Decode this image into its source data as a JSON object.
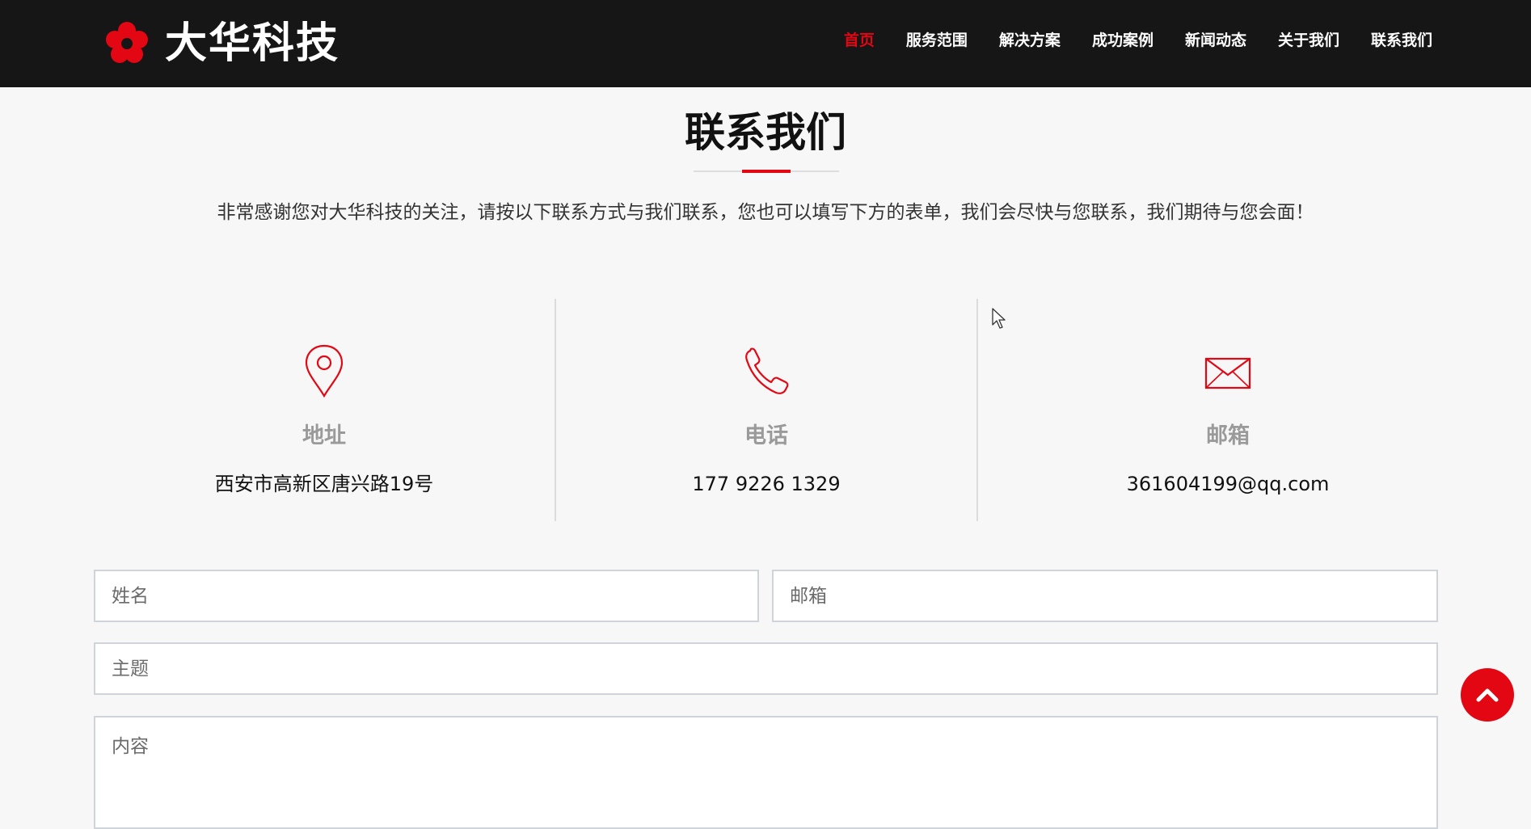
{
  "header": {
    "logo_text": "大华科技",
    "nav": [
      "首页",
      "服务范围",
      "解决方案",
      "成功案例",
      "新闻动态",
      "关于我们",
      "联系我们"
    ],
    "active_nav": "首页",
    "background": "#161616",
    "accent": "#e30613"
  },
  "contact": {
    "title": "联系我们",
    "intro": "非常感谢您对大华科技的关注，请按以下联系方式与我们联系，您也可以填写下方的表单，我们会尽快与您联系，我们期待与您会面！",
    "items": [
      {
        "icon": "map-pin-icon",
        "label": "地址",
        "value": "西安市高新区唐兴路19号"
      },
      {
        "icon": "phone-icon",
        "label": "电话",
        "value": "177 9226 1329"
      },
      {
        "icon": "mail-icon",
        "label": "邮箱",
        "value": "361604199@qq.com"
      }
    ]
  },
  "form": {
    "name_placeholder": "姓名",
    "email_placeholder": "邮箱",
    "subject_placeholder": "主题",
    "content_placeholder": "内容"
  },
  "back_to_top": {
    "icon": "chevron-up-icon"
  }
}
